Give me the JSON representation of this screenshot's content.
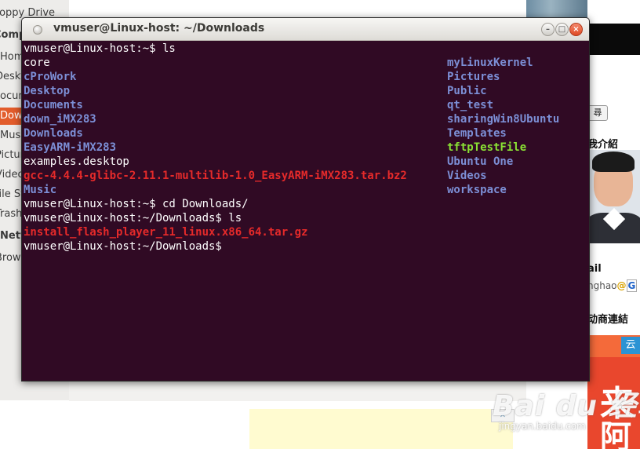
{
  "file_manager": {
    "sidebar_items": [
      {
        "label": "Floppy Drive",
        "type": "normal"
      },
      {
        "label": "Computer",
        "type": "header"
      },
      {
        "label": "Home",
        "type": "normal"
      },
      {
        "label": "Desktop",
        "type": "normal"
      },
      {
        "label": "Documents",
        "type": "normal"
      },
      {
        "label": "Downloads",
        "type": "selected"
      },
      {
        "label": "Music",
        "type": "normal"
      },
      {
        "label": "Pictures",
        "type": "normal"
      },
      {
        "label": "Videos",
        "type": "normal"
      },
      {
        "label": "File System",
        "type": "normal"
      },
      {
        "label": "Trash",
        "type": "normal"
      },
      {
        "label": "Network",
        "type": "header"
      },
      {
        "label": "Browse Network",
        "type": "normal"
      }
    ]
  },
  "web_page": {
    "search_button": "尋",
    "intro_title": "我介紹",
    "mail_label": "ail",
    "mail_value": "nghao",
    "mail_at": "@",
    "mail_g": "G",
    "links_title": "动商連結",
    "banner_tag": "云",
    "banner_big_1": "来",
    "banner_big_2": "阿"
  },
  "ad": {
    "close_label": "✕"
  },
  "watermark": {
    "logo": "Bai du 经验",
    "url": "jingyan.baidu.com"
  },
  "terminal": {
    "title": "vmuser@Linux-host: ~/Downloads",
    "buttons": {
      "minimize": "–",
      "maximize": "□",
      "close": "×"
    },
    "lines": [
      {
        "col": 1,
        "row": 0,
        "text": "vmuser@Linux-host:~$ ls",
        "kind": "file"
      },
      {
        "col": 1,
        "row": 1,
        "text": "core",
        "kind": "file"
      },
      {
        "col": 1,
        "row": 2,
        "text": "cProWork",
        "kind": "dir"
      },
      {
        "col": 1,
        "row": 3,
        "text": "Desktop",
        "kind": "dir"
      },
      {
        "col": 1,
        "row": 4,
        "text": "Documents",
        "kind": "dir"
      },
      {
        "col": 1,
        "row": 5,
        "text": "down_iMX283",
        "kind": "dir"
      },
      {
        "col": 1,
        "row": 6,
        "text": "Downloads",
        "kind": "dir"
      },
      {
        "col": 1,
        "row": 7,
        "text": "EasyARM-iMX283",
        "kind": "dir"
      },
      {
        "col": 1,
        "row": 8,
        "text": "examples.desktop",
        "kind": "file"
      },
      {
        "col": 1,
        "row": 9,
        "text": "gcc-4.4.4-glibc-2.11.1-multilib-1.0_EasyARM-iMX283.tar.bz2",
        "kind": "arc"
      },
      {
        "col": 1,
        "row": 10,
        "text": "Music",
        "kind": "dir"
      },
      {
        "col": 2,
        "row": 1,
        "text": "myLinuxKernel",
        "kind": "dir"
      },
      {
        "col": 2,
        "row": 2,
        "text": "Pictures",
        "kind": "dir"
      },
      {
        "col": 2,
        "row": 3,
        "text": "Public",
        "kind": "dir"
      },
      {
        "col": 2,
        "row": 4,
        "text": "qt_test",
        "kind": "dir"
      },
      {
        "col": 2,
        "row": 5,
        "text": "sharingWin8Ubuntu",
        "kind": "dir"
      },
      {
        "col": 2,
        "row": 6,
        "text": "Templates",
        "kind": "dir"
      },
      {
        "col": 2,
        "row": 7,
        "text": "tftpTestFile",
        "kind": "exe"
      },
      {
        "col": 2,
        "row": 8,
        "text": "Ubuntu One",
        "kind": "dir"
      },
      {
        "col": 2,
        "row": 9,
        "text": "Videos",
        "kind": "dir"
      },
      {
        "col": 2,
        "row": 10,
        "text": "workspace",
        "kind": "dir"
      },
      {
        "col": 1,
        "row": 11,
        "text": "vmuser@Linux-host:~$ cd Downloads/",
        "kind": "file"
      },
      {
        "col": 1,
        "row": 12,
        "text": "vmuser@Linux-host:~/Downloads$ ls",
        "kind": "file"
      },
      {
        "col": 1,
        "row": 13,
        "text": "install_flash_player_11_linux.x86_64.tar.gz",
        "kind": "arc"
      },
      {
        "col": 1,
        "row": 14,
        "text": "vmuser@Linux-host:~/Downloads$ ",
        "kind": "file"
      }
    ]
  }
}
